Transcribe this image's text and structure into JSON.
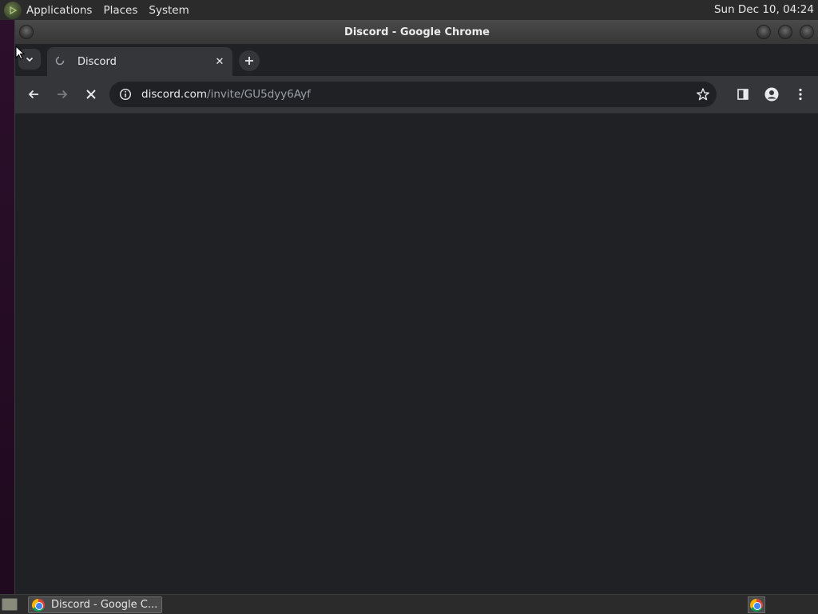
{
  "top_panel": {
    "menus": [
      "Applications",
      "Places",
      "System"
    ],
    "clock": "Sun Dec 10, 04:24"
  },
  "window": {
    "title": "Discord - Google Chrome"
  },
  "tabs": [
    {
      "title": "Discord",
      "favicon": "discord-icon",
      "loading": true
    }
  ],
  "omnibox": {
    "domain": "discord.com",
    "path": "/invite/GU5dyy6Ayf"
  },
  "taskbar": {
    "items": [
      {
        "label": "Discord - Google C...",
        "icon": "chrome-icon"
      }
    ]
  },
  "colors": {
    "chrome_bg": "#202124",
    "toolbar_bg": "#35363a",
    "panel_bg": "#2b2b2b"
  }
}
